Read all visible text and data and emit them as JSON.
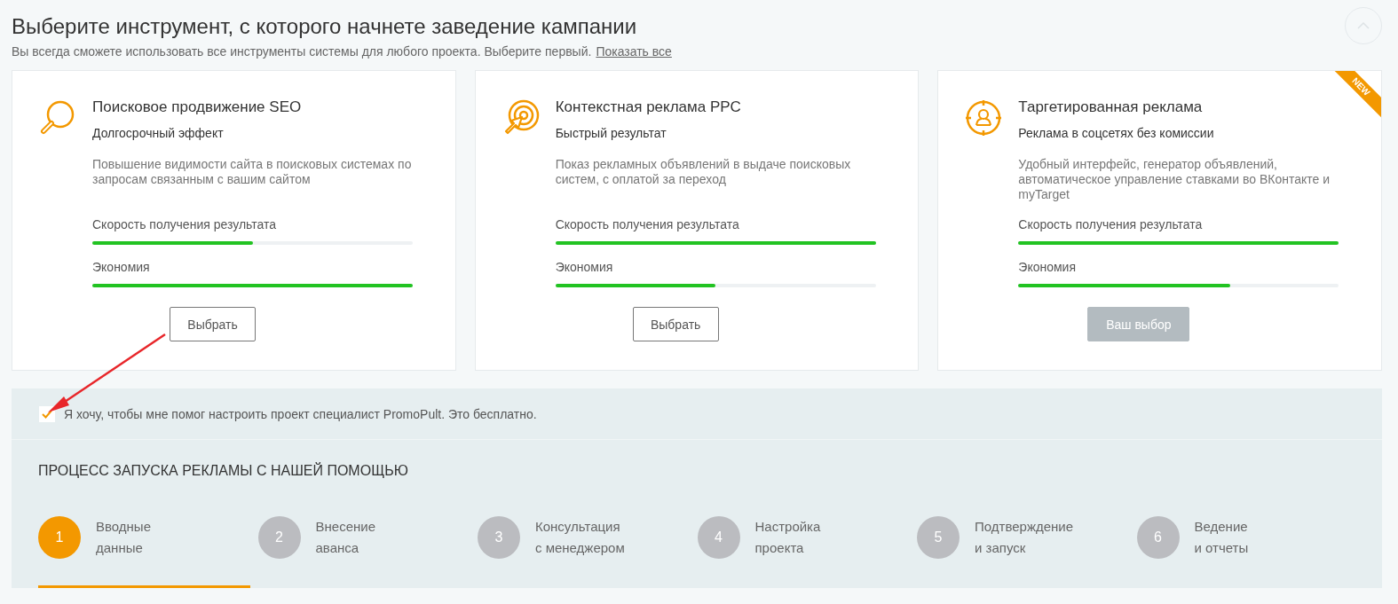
{
  "header": {
    "title": "Выберите инструмент, с которого начнете заведение кампании",
    "subtitle": "Вы всегда сможете использовать все инструменты системы для любого проекта. Выберите первый.",
    "link": "Показать все"
  },
  "cards": [
    {
      "title": "Поисковое продвижение SEO",
      "subtitle": "Долгосрочный эффект",
      "description": "Повышение видимости сайта в поисковых системах по запросам связанным с вашим сайтом",
      "metrics": [
        {
          "label": "Скорость получения результата",
          "level": 0.5
        },
        {
          "label": "Экономия",
          "level": 1
        }
      ],
      "button": {
        "label": "Выбрать",
        "selected": false
      }
    },
    {
      "title": "Контекстная реклама PPC",
      "subtitle": "Быстрый результат",
      "description": "Показ рекламных объявлений в выдаче поисковых систем, с оплатой за переход",
      "metrics": [
        {
          "label": "Скорость получения результата",
          "level": 1
        },
        {
          "label": "Экономия",
          "level": 0.5
        }
      ],
      "button": {
        "label": "Выбрать",
        "selected": false
      }
    },
    {
      "title": "Таргетированная реклама",
      "subtitle": "Реклама в соцсетях без комиссии",
      "description": "Удобный интерфейс, генератор объявлений, автоматическое управление ставками во ВКонтакте и myTarget",
      "badge": "NEW",
      "metrics": [
        {
          "label": "Скорость получения результата",
          "level": 1
        },
        {
          "label": "Экономия",
          "level": 0.66
        }
      ],
      "button": {
        "label": "Ваш выбор",
        "selected": true
      }
    }
  ],
  "consent": {
    "label": "Я хочу, чтобы мне помог настроить проект специалист PromoPult. Это бесплатно.",
    "checked": true
  },
  "process": {
    "title": "ПРОЦЕСС ЗАПУСКА РЕКЛАМЫ С НАШЕЙ ПОМОЩЬЮ",
    "steps": [
      {
        "number": "1",
        "label": [
          "Вводные",
          "данные"
        ],
        "selected": true
      },
      {
        "number": "2",
        "label": [
          "Внесение",
          "аванса"
        ],
        "selected": false
      },
      {
        "number": "3",
        "label": [
          "Консультация",
          "с менеджером"
        ],
        "selected": false
      },
      {
        "number": "4",
        "label": [
          "Настройка",
          "проекта"
        ],
        "selected": false
      },
      {
        "number": "5",
        "label": [
          "Подтверждение",
          "и запуск"
        ],
        "selected": false
      },
      {
        "number": "6",
        "label": [
          "Ведение",
          "и отчеты"
        ],
        "selected": false
      }
    ]
  }
}
